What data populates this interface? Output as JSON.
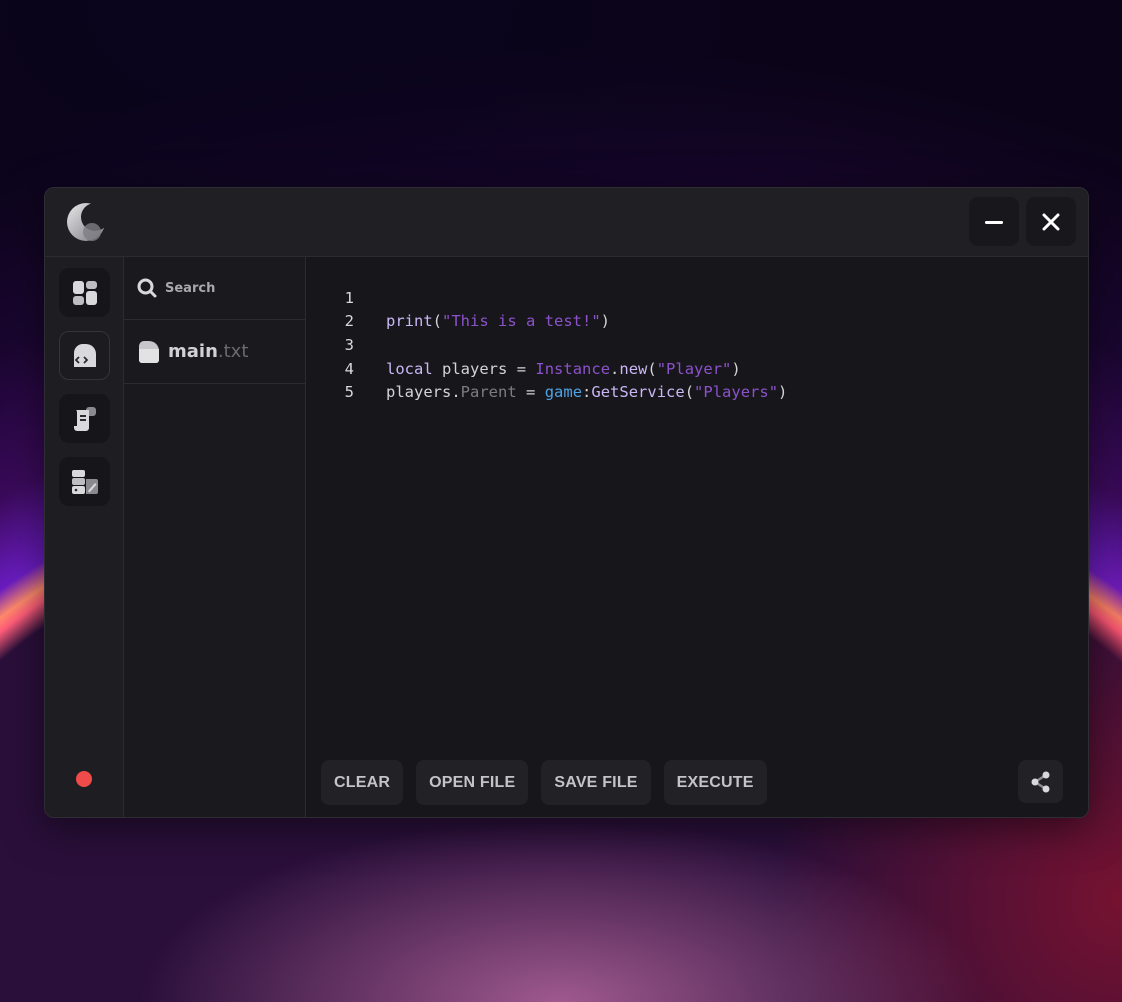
{
  "app": {
    "minimize_icon": "minimize-icon",
    "close_icon": "close-icon",
    "logo_icon": "moon-logo-icon"
  },
  "sidebar": {
    "items": [
      {
        "name": "dashboard",
        "icon": "dashboard-icon"
      },
      {
        "name": "editor",
        "icon": "code-editor-icon",
        "active": true
      },
      {
        "name": "scripts",
        "icon": "script-scroll-icon"
      },
      {
        "name": "settings",
        "icon": "storage-edit-icon"
      }
    ],
    "status_color": "#f04b4b"
  },
  "files": {
    "search_label": "Search",
    "items": [
      {
        "name": "main",
        "ext": ".txt"
      }
    ]
  },
  "editor": {
    "line_numbers": [
      "1",
      "2",
      "3",
      "4",
      "5"
    ]
  },
  "actions": {
    "clear": "CLEAR",
    "open_file": "OPEN FILE",
    "save_file": "SAVE FILE",
    "execute": "EXECUTE",
    "share_icon": "share-icon"
  }
}
